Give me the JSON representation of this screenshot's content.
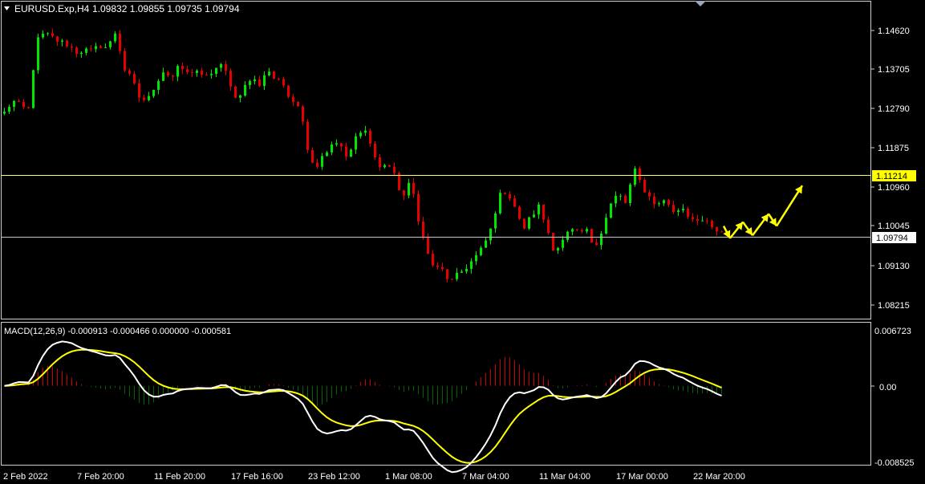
{
  "header": {
    "symbol_timeframe": "EURUSD.Exp,H4",
    "ohlc": "1.09832 1.09855 1.09735 1.09794"
  },
  "price_panel": {
    "y_ticks": [
      "1.14620",
      "1.13705",
      "1.12790",
      "1.11875",
      "1.10960",
      "1.10045",
      "1.09130",
      "1.08215"
    ],
    "hline_yellow": "1.11214",
    "hline_current": "1.09794",
    "colors": {
      "up": "#00e600",
      "down": "#e60000",
      "hline_yellow": "#ffff66",
      "hline_gray": "#c8c8c8",
      "arrows": "#ffff00"
    }
  },
  "macd_panel": {
    "label": "MACD(12,26,9) -0.000913 -0.000466 0.000000 -0.000581",
    "y_ticks": [
      "0.006723",
      "0.00",
      "-0.008525"
    ],
    "colors": {
      "macd": "#ffffff",
      "signal": "#ffff00",
      "hist_pos": "#c80000",
      "hist_neg": "#006400"
    }
  },
  "x_axis": {
    "labels": [
      "2 Feb 2022",
      "7 Feb 20:00",
      "11 Feb 20:00",
      "17 Feb 16:00",
      "23 Feb 12:00",
      "1 Mar 08:00",
      "7 Mar 04:00",
      "11 Mar 04:00",
      "17 Mar 00:00",
      "22 Mar 20:00"
    ]
  },
  "chart_data": {
    "type": "candlestick",
    "symbol": "EURUSD.Exp",
    "timeframe": "H4",
    "x_labels": [
      "2 Feb 2022",
      "7 Feb 20:00",
      "11 Feb 20:00",
      "17 Feb 16:00",
      "23 Feb 12:00",
      "1 Mar 08:00",
      "7 Mar 04:00",
      "11 Mar 04:00",
      "17 Mar 00:00",
      "22 Mar 20:00"
    ],
    "ylim": [
      1.078,
      1.1514
    ],
    "close_path": [
      1.1275,
      1.1305,
      1.129,
      1.128,
      1.145,
      1.147,
      1.146,
      1.145,
      1.1443,
      1.1425,
      1.143,
      1.1425,
      1.1443,
      1.1435,
      1.1478,
      1.1385,
      1.1355,
      1.131,
      1.1305,
      1.135,
      1.138,
      1.136,
      1.139,
      1.137,
      1.1385,
      1.1355,
      1.1375,
      1.1393,
      1.137,
      1.131,
      1.1335,
      1.136,
      1.1345,
      1.1385,
      1.1355,
      1.1345,
      1.131,
      1.1295,
      1.1195,
      1.1135,
      1.1175,
      1.119,
      1.1205,
      1.1155,
      1.121,
      1.1245,
      1.1195,
      1.1135,
      1.1155,
      1.1115,
      1.1065,
      1.1105,
      1.101,
      1.093,
      1.089,
      1.0885,
      1.0855,
      1.0875,
      1.0895,
      1.0915,
      1.094,
      1.0985,
      1.1065,
      1.1085,
      1.1045,
      1.0985,
      1.1015,
      1.1045,
      1.0995,
      1.0935,
      1.0955,
      1.0985,
      1.0975,
      1.0985,
      1.0945,
      1.0985,
      1.1045,
      1.1075,
      1.105,
      1.1135,
      1.1095,
      1.1065,
      1.1045,
      1.1065,
      1.1025,
      1.1045,
      1.1015,
      1.1015,
      1.1003,
      1.0985,
      1.0975
    ],
    "candles_shown": 150,
    "forecast_arrows": "zigzag up",
    "macd": {
      "macd": -0.000913,
      "signal": -0.000466,
      "zero": 0.0,
      "histogram": -0.000581,
      "ylim": [
        -0.008525,
        0.006723
      ]
    }
  }
}
